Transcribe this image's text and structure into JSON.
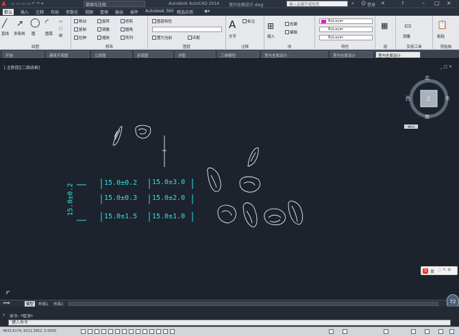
{
  "title_bar": {
    "app_title": "Autodesk AutoCAD 2014",
    "file_name": "室内全面设计.dwg",
    "search_placeholder": "键入关键字或短语",
    "login": "登录",
    "workspace": "草图与注释"
  },
  "ribbon_tabs": [
    "默认",
    "插入",
    "注释",
    "布局",
    "参数化",
    "视图",
    "管理",
    "输出",
    "插件",
    "Autodesk 360",
    "精选应用"
  ],
  "ribbon_panels": [
    {
      "label": "绘图",
      "buttons": [
        "直线",
        "多段线",
        "圆",
        "圆弧"
      ]
    },
    {
      "label": "修改",
      "buttons": [
        "移动",
        "旋转",
        "修剪",
        "复制",
        "镜像",
        "圆角",
        "拉伸",
        "缩放",
        "阵列"
      ]
    },
    {
      "label": "图层",
      "buttons": [
        "图层特性",
        "置为当前",
        "匹配"
      ]
    },
    {
      "label": "注释",
      "buttons": [
        "文字",
        "标注"
      ]
    },
    {
      "label": "块",
      "buttons": [
        "插入",
        "创建",
        "编辑"
      ]
    },
    {
      "label": "特性",
      "buttons": [
        "ByLayer",
        "ByLayer",
        "ByLayer"
      ]
    },
    {
      "label": "组",
      "buttons": [
        "组"
      ]
    },
    {
      "label": "实用工具",
      "buttons": [
        "测量"
      ]
    },
    {
      "label": "剪贴板",
      "buttons": [
        "粘贴"
      ]
    }
  ],
  "doc_tabs": [
    "开始",
    "建筑平面图",
    "立面图",
    "剖面图",
    "详图",
    "三维模型",
    "室内全面设计",
    "室内全面设计",
    "室内全面设计"
  ],
  "viewport": {
    "label": "[-][俯视][二维线框]",
    "controls": "_ □ ×"
  },
  "viewcube": {
    "north": "北",
    "south": "南",
    "east": "东",
    "west": "西",
    "top": "上",
    "wcs": "WCS"
  },
  "dimensions": {
    "vertical": "15.0±0.2",
    "col1": [
      "15.0±0.2",
      "15.0±0.3",
      "15.0±1.5"
    ],
    "col2": [
      "15.0±3.0",
      "15.0±2.0",
      "15.0±1.0"
    ]
  },
  "layout_tabs": [
    "模型",
    "布局1",
    "布局2"
  ],
  "command": {
    "history": "命令: *取消*",
    "prompt": "键入命令"
  },
  "status": {
    "coords": "4833.6174, 6311.3952, 0.0000"
  },
  "ime": {
    "label": "英"
  },
  "round_button": "72"
}
